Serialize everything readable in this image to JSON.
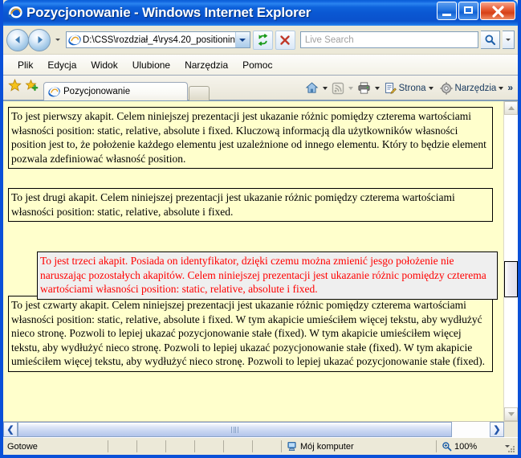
{
  "window": {
    "title": "Pozycjonowanie - Windows Internet Explorer",
    "buttons": {
      "minimize": "minimize",
      "maximize": "maximize",
      "close": "close"
    }
  },
  "address_bar": {
    "back": "Wstecz",
    "forward": "Dalej",
    "url": "D:\\CSS\\rozdział_4\\rys4.20_positionin",
    "refresh": "Odśwież",
    "stop": "Zatrzymaj",
    "search_placeholder": "Live Search"
  },
  "menu": {
    "items": [
      {
        "label": "Plik"
      },
      {
        "label": "Edycja"
      },
      {
        "label": "Widok"
      },
      {
        "label": "Ulubione"
      },
      {
        "label": "Narzędzia"
      },
      {
        "label": "Pomoc"
      }
    ]
  },
  "tabs": {
    "favorites_tooltip": "Ulubione",
    "add_favorite_tooltip": "Dodaj do ulubionych",
    "active_tab": "Pozycjonowanie",
    "new_tab": ""
  },
  "command_bar": {
    "home": "Strona główna",
    "feeds": "Kanały informacyjne",
    "print": "Drukuj",
    "page": "Strona",
    "tools": "Narzędzia",
    "overflow": "»"
  },
  "page": {
    "background": "#ffffcc",
    "paragraphs": [
      {
        "id": "para1",
        "color": "#000000",
        "text": "To jest pierwszy akapit. Celem niniejszej prezentacji jest ukazanie różnic pomiędzy czterema wartościami własności position: static, relative, absolute i fixed. Kluczową informacją dla użytkowników własności position jest to, że położenie każdego elementu jest uzależnione od innego elementu. Który to będzie element pozwala zdefiniować własność position."
      },
      {
        "id": "para2",
        "color": "#000000",
        "text": "To jest drugi akapit. Celem niniejszej prezentacji jest ukazanie różnic pomiędzy czterema wartościami własności position: static, relative, absolute i fixed."
      },
      {
        "id": "para3",
        "color": "#ff0000",
        "background": "#efefef",
        "text": "To jest trzeci akapit. Posiada on identyfikator, dzięki czemu można zmienić jesgo położenie nie naruszając pozostałych akapitów. Celem niniejszej prezentacji jest ukazanie różnic pomiędzy czterema wartościami własności position: static, relative, absolute i fixed."
      },
      {
        "id": "para4",
        "color": "#000000",
        "text": "To jest czwarty akapit. Celem niniejszej prezentacji jest ukazanie różnic pomiędzy czterema wartościami własności position: static, relative, absolute i fixed. W tym akapicie umieściłem więcej tekstu, aby wydłużyć nieco stronę. Pozwoli to lepiej ukazać pozycjonowanie stałe (fixed). W tym akapicie umieściłem więcej tekstu, aby wydłużyć nieco stronę. Pozwoli to lepiej ukazać pozycjonowanie stałe (fixed). W tym akapicie umieściłem więcej tekstu, aby wydłużyć nieco stronę. Pozwoli to lepiej ukazać pozycjonowanie stałe (fixed)."
      }
    ]
  },
  "status_bar": {
    "status": "Gotowe",
    "zone": "Mój komputer",
    "zoom": "100%"
  },
  "colors": {
    "titlebar_blue": "#0a57d2",
    "frame_blue": "#0a50d8",
    "chrome_beige": "#ece9d8",
    "page_yellow": "#ffffcc",
    "para3_red": "#ff0000",
    "para3_bg": "#efefef"
  }
}
